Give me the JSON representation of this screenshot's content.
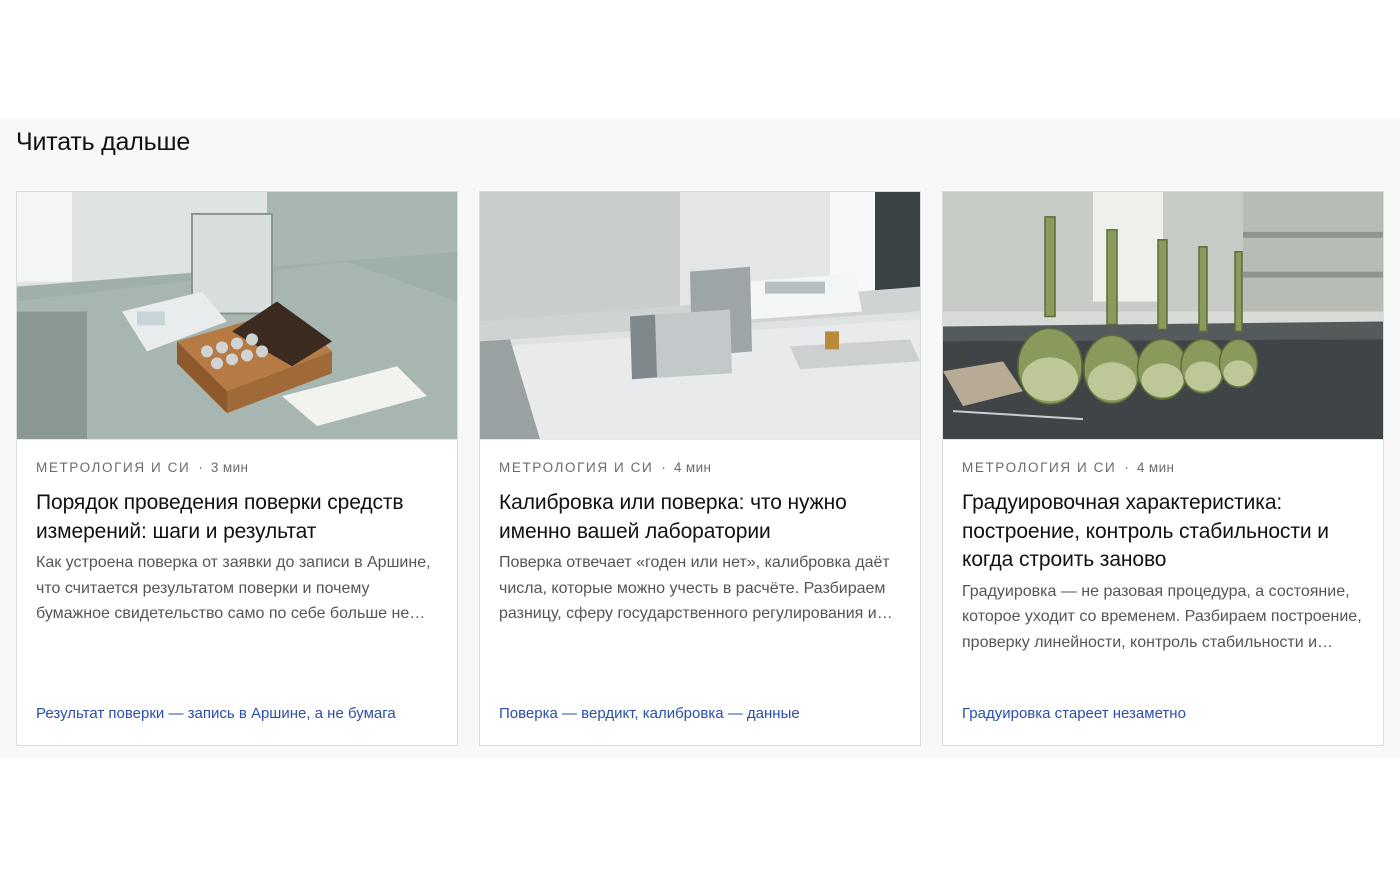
{
  "section_title": "Читать дальше",
  "cards": [
    {
      "image": "lab-balance-weights-photo",
      "category": "МЕТРОЛОГИЯ И СИ",
      "read_time": "3 мин",
      "title": "Порядок проведения поверки средств измерений: шаги и результат",
      "excerpt": "Как устроена поверка от заявки до записи в Аршине, что считается результатом поверки и почему бумажное свидетельство само по себе больше не является доказательством.",
      "tag": "Результат поверки — запись в Аршине, а не бумага"
    },
    {
      "image": "lab-calibration-block-photo",
      "category": "МЕТРОЛОГИЯ И СИ",
      "read_time": "4 мин",
      "title": "Калибровка или поверка: что нужно именно вашей лаборатории",
      "excerpt": "Поверка отвечает «годен или нет», калибровка даёт числа, которые можно учесть в расчёте. Разбираем разницу, сферу государственного регулирования и случаи, когда нужно и то, и другое.",
      "tag": "Поверка — вердикт, калибровка — данные"
    },
    {
      "image": "volumetric-flasks-photo",
      "category": "МЕТРОЛОГИЯ И СИ",
      "read_time": "4 мин",
      "title": "Градуировочная характеристика: построение, контроль стабильности и когда строить заново",
      "excerpt": "Градуировка — не разовая процедура, а состояние, которое уходит со временем. Разбираем построение, проверку линейности, контроль стабильности и признаки необходимости перестроения.",
      "tag": "Градуировка стареет незаметно"
    }
  ]
}
